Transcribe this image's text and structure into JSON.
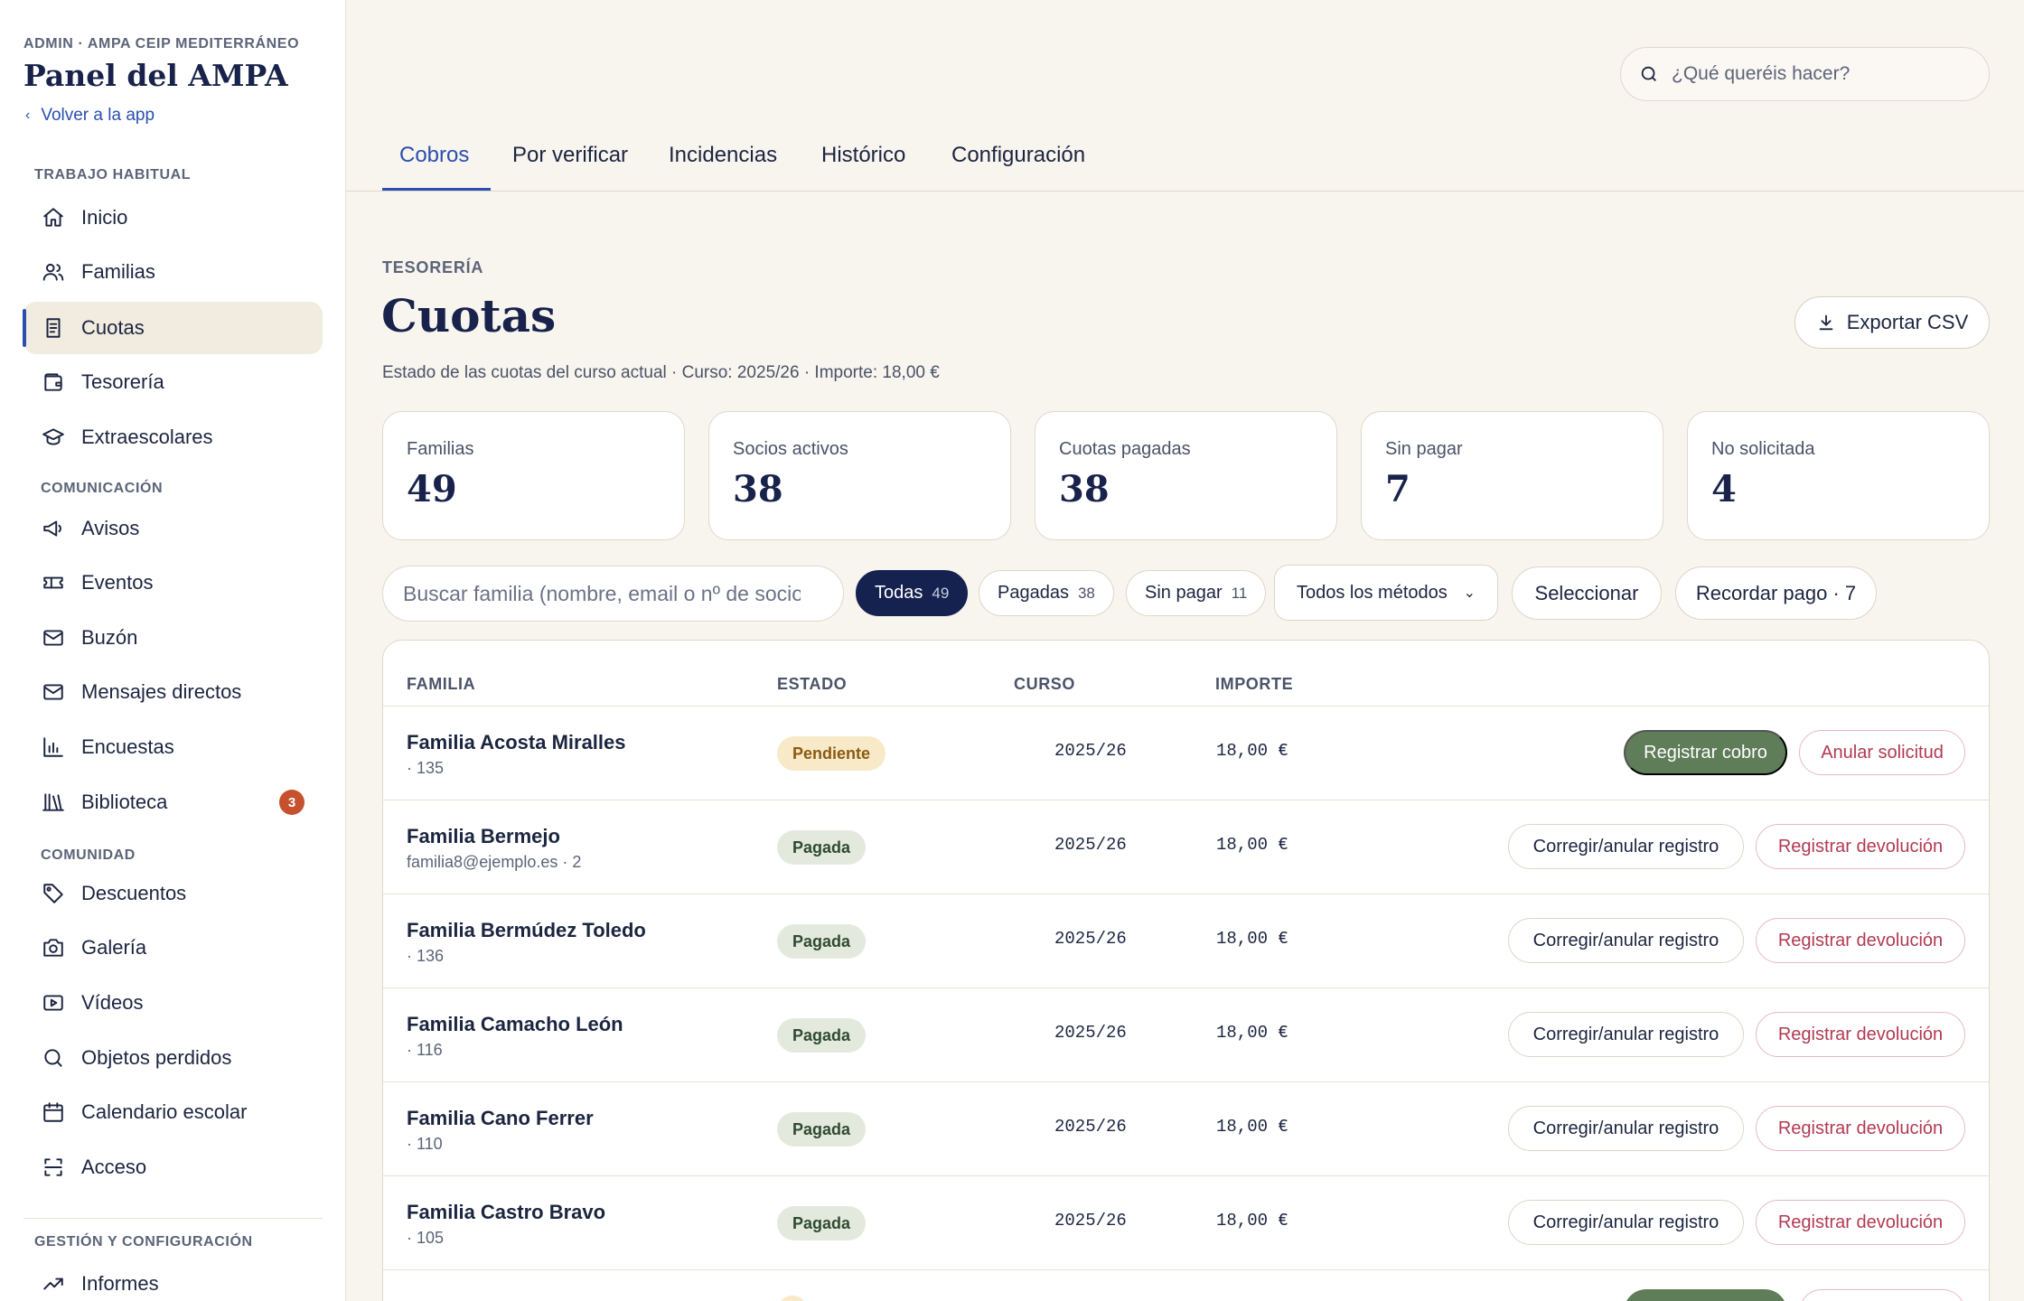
{
  "sidebar": {
    "eyebrow": "ADMIN · AMPA CEIP MEDITERRÁNEO",
    "title": "Panel del AMPA",
    "back_label": "Volver a la app",
    "sections": {
      "habitual": "TRABAJO HABITUAL",
      "comunicacion": "COMUNICACIÓN",
      "comunidad": "COMUNIDAD",
      "gestion": "GESTIÓN Y CONFIGURACIÓN"
    },
    "items": [
      {
        "label": "Inicio",
        "icon": "home-icon"
      },
      {
        "label": "Familias",
        "icon": "users-icon"
      },
      {
        "label": "Cuotas",
        "icon": "receipt-icon",
        "active": true
      },
      {
        "label": "Tesorería",
        "icon": "wallet-icon"
      },
      {
        "label": "Extraescolares",
        "icon": "graduation-cap-icon"
      },
      {
        "label": "Avisos",
        "icon": "megaphone-icon"
      },
      {
        "label": "Eventos",
        "icon": "ticket-icon"
      },
      {
        "label": "Buzón",
        "icon": "mail-icon"
      },
      {
        "label": "Mensajes directos",
        "icon": "mail-icon"
      },
      {
        "label": "Encuestas",
        "icon": "bar-chart-icon"
      },
      {
        "label": "Biblioteca",
        "icon": "library-icon",
        "badge": "3"
      },
      {
        "label": "Descuentos",
        "icon": "tag-icon"
      },
      {
        "label": "Galería",
        "icon": "camera-icon"
      },
      {
        "label": "Vídeos",
        "icon": "video-icon"
      },
      {
        "label": "Objetos perdidos",
        "icon": "search-icon"
      },
      {
        "label": "Calendario escolar",
        "icon": "calendar-icon"
      },
      {
        "label": "Acceso",
        "icon": "scan-icon"
      },
      {
        "label": "Informes",
        "icon": "trending-icon"
      }
    ]
  },
  "topbar": {
    "search_placeholder": "¿Qué queréis hacer?"
  },
  "tabs": [
    {
      "label": "Cobros",
      "active": true
    },
    {
      "label": "Por verificar"
    },
    {
      "label": "Incidencias"
    },
    {
      "label": "Histórico"
    },
    {
      "label": "Configuración"
    }
  ],
  "header": {
    "eyebrow": "TESORERÍA",
    "title": "Cuotas",
    "subtitle": "Estado de las cuotas del curso actual · Curso: 2025/26 · Importe: 18,00 €",
    "export_label": "Exportar CSV"
  },
  "stats": [
    {
      "label": "Familias",
      "value": "49"
    },
    {
      "label": "Socios activos",
      "value": "38"
    },
    {
      "label": "Cuotas pagadas",
      "value": "38"
    },
    {
      "label": "Sin pagar",
      "value": "7"
    },
    {
      "label": "No solicitada",
      "value": "4"
    }
  ],
  "filters": {
    "search_placeholder": "Buscar familia (nombre, email o nº de socio)",
    "chips": [
      {
        "label": "Todas",
        "count": "49",
        "active": true
      },
      {
        "label": "Pagadas",
        "count": "38"
      },
      {
        "label": "Sin pagar",
        "count": "11"
      }
    ],
    "method_select": "Todos los métodos",
    "select_label": "Seleccionar",
    "remind_label": "Recordar pago · 7"
  },
  "table": {
    "columns": [
      "FAMILIA",
      "ESTADO",
      "CURSO",
      "IMPORTE"
    ],
    "rows": [
      {
        "name": "Familia Acosta Miralles",
        "sub": "· 135",
        "status": "Pendiente",
        "course": "2025/26",
        "amount": "18,00 €",
        "actions": [
          "Registrar cobro",
          "Anular solicitud"
        ]
      },
      {
        "name": "Familia Bermejo",
        "sub": "familia8@ejemplo.es · 2",
        "status": "Pagada",
        "course": "2025/26",
        "amount": "18,00 €",
        "actions": [
          "Corregir/anular registro",
          "Registrar devolución"
        ]
      },
      {
        "name": "Familia Bermúdez Toledo",
        "sub": "· 136",
        "status": "Pagada",
        "course": "2025/26",
        "amount": "18,00 €",
        "actions": [
          "Corregir/anular registro",
          "Registrar devolución"
        ]
      },
      {
        "name": "Familia Camacho León",
        "sub": "· 116",
        "status": "Pagada",
        "course": "2025/26",
        "amount": "18,00 €",
        "actions": [
          "Corregir/anular registro",
          "Registrar devolución"
        ]
      },
      {
        "name": "Familia Cano Ferrer",
        "sub": "· 110",
        "status": "Pagada",
        "course": "2025/26",
        "amount": "18,00 €",
        "actions": [
          "Corregir/anular registro",
          "Registrar devolución"
        ]
      },
      {
        "name": "Familia Castro Bravo",
        "sub": "· 105",
        "status": "Pagada",
        "course": "2025/26",
        "amount": "18,00 €",
        "actions": [
          "Corregir/anular registro",
          "Registrar devolución"
        ]
      }
    ]
  },
  "colors": {
    "accent": "#2b4fb0",
    "navy": "#15224f",
    "success": "#5e7d58",
    "danger": "#b23a52",
    "badge": "#c5512f"
  }
}
